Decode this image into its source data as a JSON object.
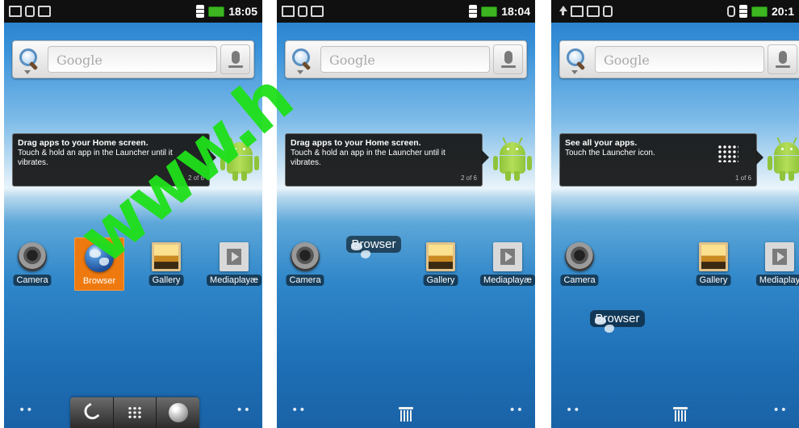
{
  "search": {
    "placeholder": "Google"
  },
  "screens": [
    {
      "status": {
        "time": "18:05"
      },
      "tooltip": {
        "title": "Drag apps to your Home screen.",
        "body": "Touch & hold an app in the Launcher until it vibrates.",
        "page": "2 of 6"
      },
      "apps": {
        "camera": "Camera",
        "browser": "Browser",
        "gallery": "Gallery",
        "mediaplayer": "Mediaplayæ"
      },
      "watermark": "www.h"
    },
    {
      "status": {
        "time": "18:04"
      },
      "tooltip": {
        "title": "Drag apps to your Home screen.",
        "body": "Touch & hold an app in the Launcher until it vibrates.",
        "page": "2 of 6"
      },
      "apps": {
        "camera": "Camera",
        "browser": "Browser",
        "gallery": "Gallery",
        "mediaplayer": "Mediaplayæ"
      }
    },
    {
      "status": {
        "time": "20:1"
      },
      "tooltip": {
        "title": "See all your apps.",
        "body": "Touch the Launcher icon.",
        "page": "1 of 6"
      },
      "apps": {
        "camera": "Camera",
        "browser": "Browser",
        "gallery": "Gallery",
        "mediaplayer": "Mediaplay"
      }
    }
  ],
  "colors": {
    "accent_selected": "#ee7a0f",
    "watermark": "#1fe01a",
    "battery": "#3cb521"
  }
}
